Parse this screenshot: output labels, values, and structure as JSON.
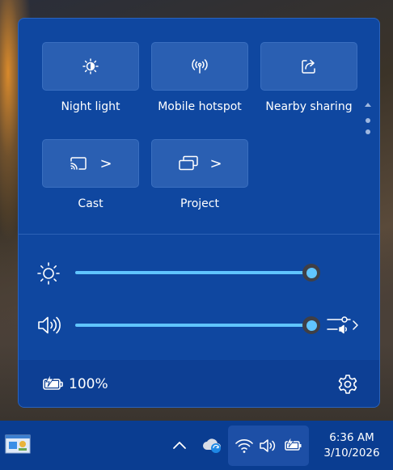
{
  "quick_settings": {
    "tiles": [
      {
        "label": "Night light",
        "icon": "night-light-icon"
      },
      {
        "label": "Mobile hotspot",
        "icon": "hotspot-icon"
      },
      {
        "label": "Nearby sharing",
        "icon": "share-icon"
      },
      {
        "label": "Cast",
        "icon": "cast-icon",
        "chevron": ">"
      },
      {
        "label": "Project",
        "icon": "project-icon",
        "chevron": ">"
      }
    ],
    "brightness": {
      "icon": "brightness-icon",
      "value_percent": 100
    },
    "volume": {
      "icon": "speaker-icon",
      "value_percent": 100
    }
  },
  "footer": {
    "battery_text": "100%",
    "battery_icon": "battery-charging-icon",
    "settings_icon": "gear-icon"
  },
  "taskbar": {
    "clock_time": "6:36 AM",
    "clock_date": "3/10/2026"
  },
  "colors": {
    "panel": "#0f47a0",
    "tile": "#2a5fb2",
    "accent": "#60c5ff",
    "taskbar": "#0a3d91"
  }
}
